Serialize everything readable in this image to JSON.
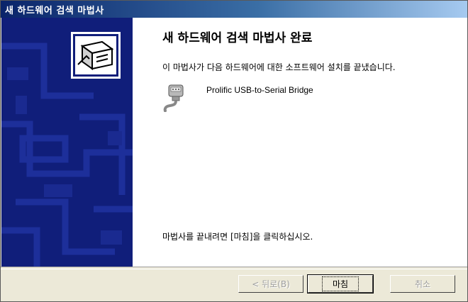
{
  "window": {
    "title": "새 하드웨어 검색 마법사"
  },
  "content": {
    "heading": "새 하드웨어 검색 마법사 완료",
    "description": "이 마법사가 다음 하드웨어에 대한 소프트웨어 설치를 끝냈습니다.",
    "device_name": "Prolific USB-to-Serial Bridge",
    "finish_hint": "마법사를 끝내려면 [마침]을 클릭하십시오."
  },
  "buttons": {
    "back": "< 뒤로(B)",
    "finish": "마침",
    "cancel": "취소"
  },
  "icons": {
    "wizard": "hardware-wizard-icon",
    "device": "usb-plug-icon"
  },
  "colors": {
    "side_panel": "#101e7a",
    "title_bar_start": "#0a246a",
    "title_bar_end": "#a6caf0"
  }
}
